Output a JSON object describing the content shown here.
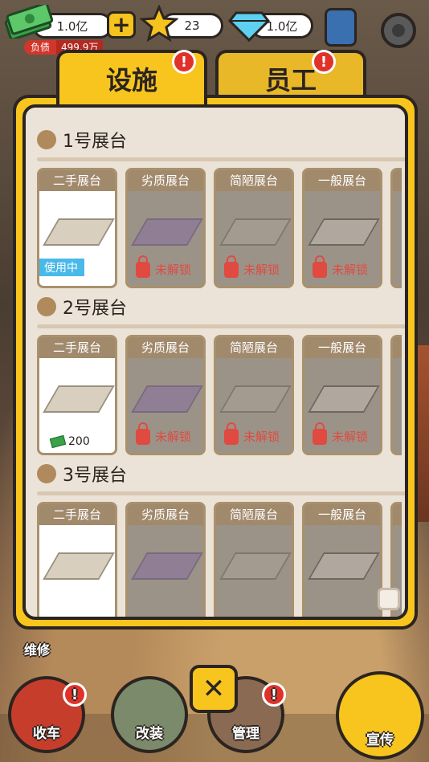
{
  "top": {
    "cash": "1.0亿",
    "debt_label": "负债",
    "debt_value": "499.9万",
    "stars": "23",
    "diamonds": "1.0亿"
  },
  "tabs": [
    {
      "label": "设施",
      "active": true,
      "badge": "!"
    },
    {
      "label": "员工",
      "active": false,
      "badge": "!"
    }
  ],
  "sections": [
    {
      "title": "1号展台",
      "cards": [
        {
          "name": "二手展台",
          "status": "使用中"
        },
        {
          "name": "劣质展台",
          "status": "未解锁"
        },
        {
          "name": "简陋展台",
          "status": "未解锁"
        },
        {
          "name": "一般展台",
          "status": "未解锁"
        }
      ]
    },
    {
      "title": "2号展台",
      "cards": [
        {
          "name": "二手展台",
          "price": "200"
        },
        {
          "name": "劣质展台",
          "status": "未解锁"
        },
        {
          "name": "简陋展台",
          "status": "未解锁"
        },
        {
          "name": "一般展台",
          "status": "未解锁"
        }
      ]
    },
    {
      "title": "3号展台",
      "cards": [
        {
          "name": "二手展台"
        },
        {
          "name": "劣质展台"
        },
        {
          "name": "简陋展台"
        },
        {
          "name": "一般展台"
        }
      ]
    }
  ],
  "bottom": {
    "repair": "维修",
    "nav": [
      "收车",
      "改装",
      "管理",
      "宣传"
    ],
    "badge": "!",
    "close": "✕"
  },
  "colors": {
    "accent": "#f8c51e",
    "outline": "#2b2420",
    "panel": "#ece3d8",
    "badge": "#e0322b",
    "inuse": "#49b9e9"
  }
}
